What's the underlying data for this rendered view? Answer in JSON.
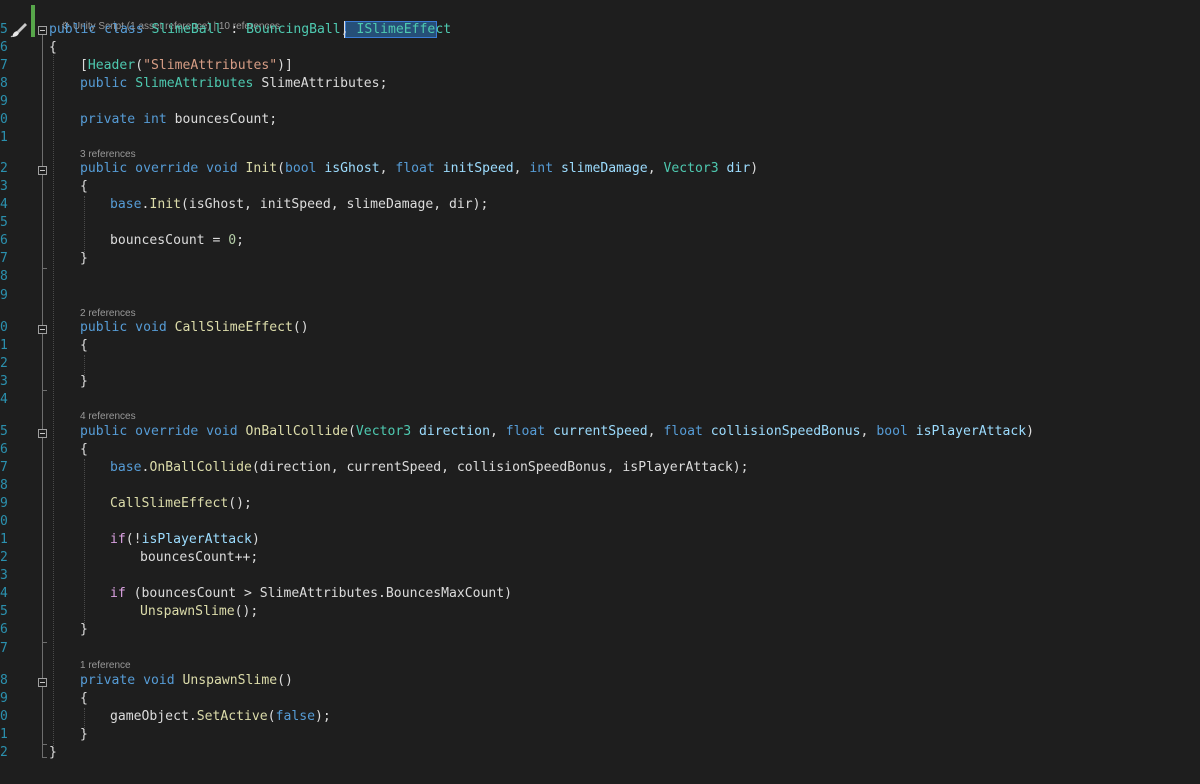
{
  "editor": {
    "language": "C#",
    "codelens": {
      "top": "Unity Script (1 asset reference) | 10 references",
      "init": "3 references",
      "call": "2 references",
      "collide": "4 references",
      "unspawn": "1 reference"
    },
    "line_numbers": [
      "5",
      "6",
      "7",
      "8",
      "9",
      "0",
      "1",
      "2",
      "3",
      "4",
      "5",
      "6",
      "7",
      "8",
      "9",
      "0",
      "1",
      "2",
      "3",
      "4",
      "5",
      "6",
      "7",
      "8",
      "9",
      "0",
      "1",
      "2",
      "3",
      "4",
      "5",
      "6",
      "7",
      "8",
      "9",
      "0",
      "1",
      "2"
    ],
    "lines": {
      "l5": {
        "t1": "public class ",
        "t2": "SlimeBall",
        " t3": "",
        "t3": " : ",
        "t4": "BouncingBall",
        "t5": ", ",
        "t6": "ISlimeEffect"
      },
      "l6": {
        "t1": "{"
      },
      "l7": {
        "t1": "[",
        "t2": "Header",
        "t3": "(",
        "t4": "\"SlimeAttributes\"",
        "t5": ")]"
      },
      "l8": {
        "t1": "public ",
        "t2": "SlimeAttributes",
        "t3": " SlimeAttributes;"
      },
      "l10": {
        "t1": "private ",
        "t2": "int",
        "t3": " bouncesCount;"
      },
      "l12": {
        "t1": "public override void ",
        "t2": "Init",
        "t3": "(",
        "t4": "bool ",
        "t5": "isGhost",
        "t6": ", ",
        "t7": "float ",
        "t8": "initSpeed",
        "t9": ", ",
        "t10": "int ",
        "t11": "slimeDamage",
        "t12": ", ",
        "t13": "Vector3",
        "t14": " ",
        "t15": "dir",
        "t16": ")"
      },
      "l13": {
        "t1": "{"
      },
      "l14": {
        "t1": "base",
        "t2": ".",
        "t3": "Init",
        "t4": "(isGhost, initSpeed, slimeDamage, dir);"
      },
      "l16": {
        "t1": "bouncesCount = ",
        "t2": "0",
        "t3": ";"
      },
      "l17": {
        "t1": "}"
      },
      "l20": {
        "t1": "public void ",
        "t2": "CallSlimeEffect",
        "t3": "()"
      },
      "l21": {
        "t1": "{"
      },
      "l23": {
        "t1": "}"
      },
      "l25": {
        "t1": "public override void ",
        "t2": "OnBallCollide",
        "t3": "(",
        "t4": "Vector3",
        "t5": " ",
        "t6": "direction",
        "t7": ", ",
        "t8": "float ",
        "t9": "currentSpeed",
        "t10": ", ",
        "t11": "float ",
        "t12": "collisionSpeedBonus",
        "t13": ", ",
        "t14": "bool ",
        "t15": "isPlayerAttack",
        "t16": ")"
      },
      "l26": {
        "t1": "{"
      },
      "l27": {
        "t1": "base",
        "t2": ".",
        "t3": "OnBallCollide",
        "t4": "(direction, currentSpeed, collisionSpeedBonus, isPlayerAttack);"
      },
      "l29": {
        "t1": "CallSlimeEffect",
        "t2": "();"
      },
      "l31": {
        "t1": "if",
        "t2": "(!",
        "t3": "isPlayerAttack",
        "t4": ")"
      },
      "l32": {
        "t1": "bouncesCount++;"
      },
      "l34": {
        "t1": "if",
        "t2": " (bouncesCount > SlimeAttributes.BouncesMaxCount)"
      },
      "l35": {
        "t1": "UnspawnSlime",
        "t2": "();"
      },
      "l36": {
        "t1": "}"
      },
      "l38": {
        "t1": "private void ",
        "t2": "UnspawnSlime",
        "t3": "()"
      },
      "l39": {
        "t1": "{"
      },
      "l40": {
        "t1": "gameObject.",
        "t2": "SetActive",
        "t3": "(",
        "t4": "false",
        "t5": ");"
      },
      "l41": {
        "t1": "}"
      },
      "l42": {
        "t1": "}"
      }
    }
  }
}
